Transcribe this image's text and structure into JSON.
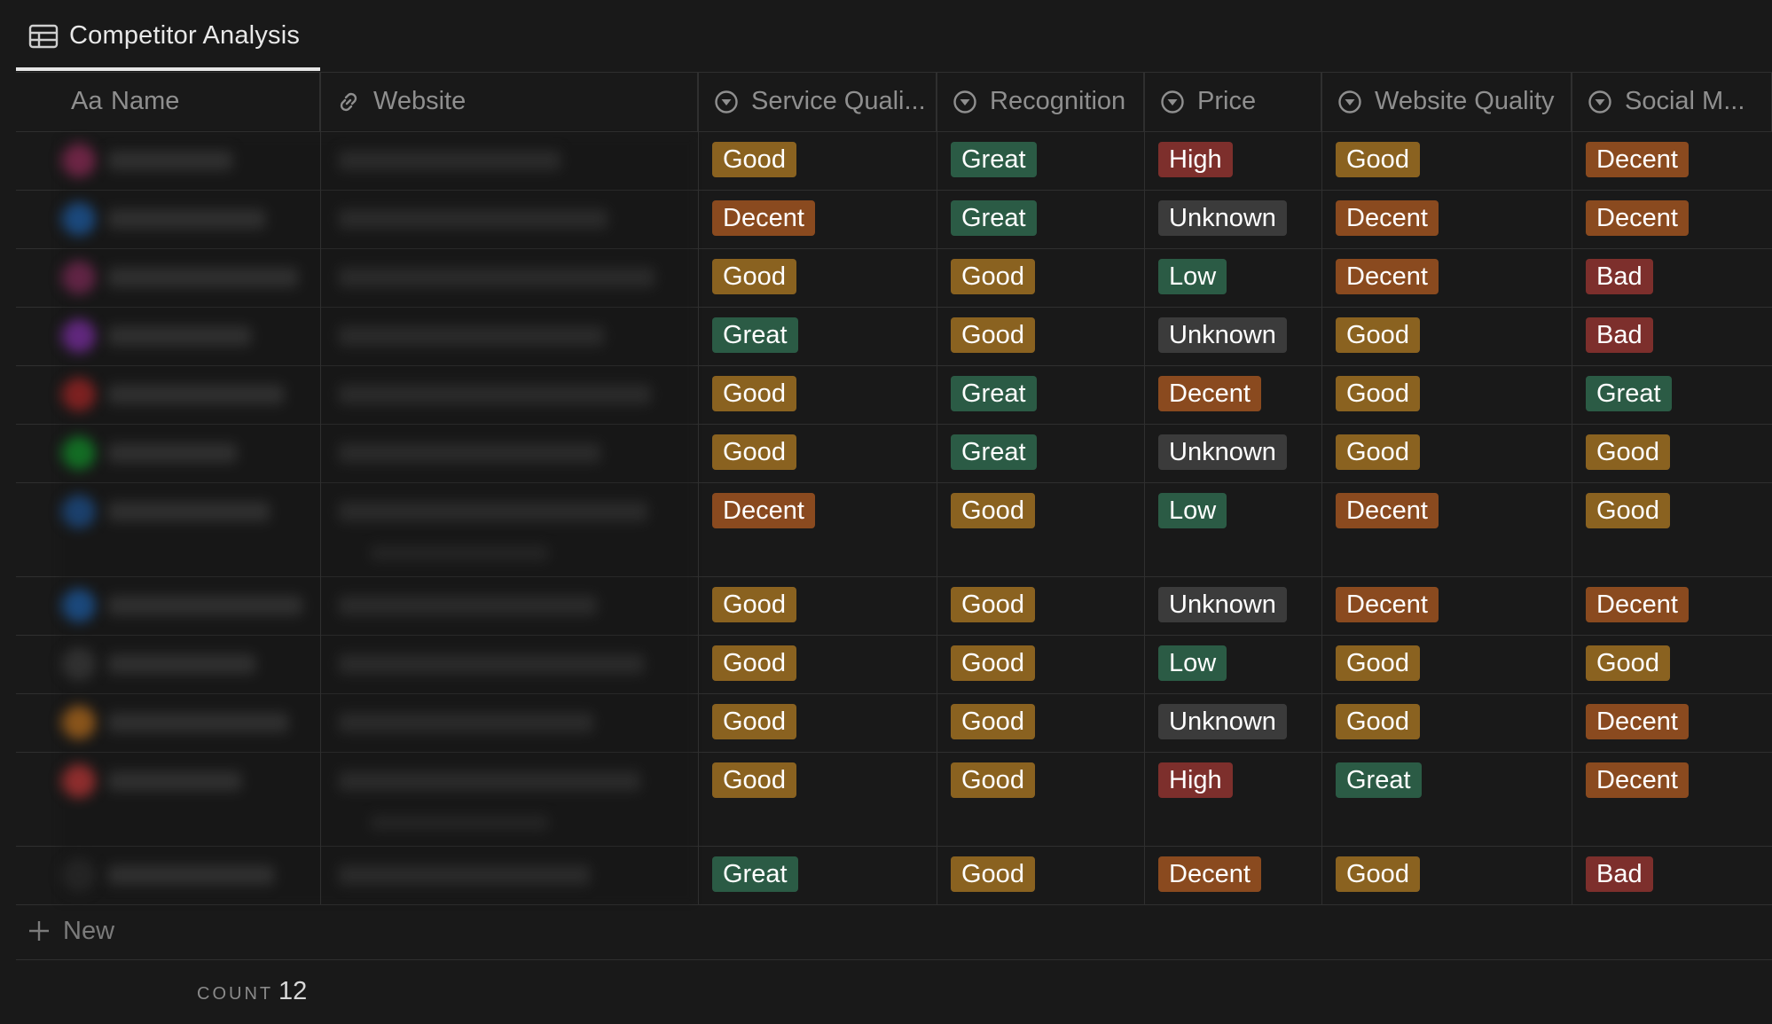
{
  "view_tab": {
    "label": "Competitor Analysis",
    "icon": "table-icon"
  },
  "columns": [
    {
      "key": "name",
      "label": "Name",
      "prefix": "Aa",
      "icon": "title-aa-icon"
    },
    {
      "key": "website",
      "label": "Website",
      "icon": "link-icon"
    },
    {
      "key": "service",
      "label": "Service Quali...",
      "icon": "select-icon"
    },
    {
      "key": "recognition",
      "label": "Recognition",
      "icon": "select-icon"
    },
    {
      "key": "price",
      "label": "Price",
      "icon": "select-icon"
    },
    {
      "key": "webquality",
      "label": "Website Quality",
      "icon": "select-icon"
    },
    {
      "key": "social",
      "label": "Social M...",
      "icon": "select-icon"
    }
  ],
  "tag_colors": {
    "Good": "#8a6220",
    "Great": "#2b5b45",
    "Decent": "#8a4a1f",
    "High": "#7d2f2c",
    "Low": "#2b5b45",
    "Unknown": "#3b3b3b",
    "Bad": "#7d2f2c"
  },
  "rows": [
    {
      "service": "Good",
      "recognition": "Great",
      "price": "High",
      "webquality": "Good",
      "social": "Decent",
      "avatar": "#8a2b55"
    },
    {
      "service": "Decent",
      "recognition": "Great",
      "price": "Unknown",
      "webquality": "Decent",
      "social": "Decent",
      "avatar": "#1e5a9e"
    },
    {
      "service": "Good",
      "recognition": "Good",
      "price": "Low",
      "webquality": "Decent",
      "social": "Bad",
      "avatar": "#7a2a55"
    },
    {
      "service": "Great",
      "recognition": "Good",
      "price": "Unknown",
      "webquality": "Good",
      "social": "Bad",
      "avatar": "#7a2ea0"
    },
    {
      "service": "Good",
      "recognition": "Great",
      "price": "Decent",
      "webquality": "Good",
      "social": "Great",
      "avatar": "#a02626"
    },
    {
      "service": "Good",
      "recognition": "Great",
      "price": "Unknown",
      "webquality": "Good",
      "social": "Good",
      "avatar": "#138a2a"
    },
    {
      "service": "Decent",
      "recognition": "Good",
      "price": "Low",
      "webquality": "Decent",
      "social": "Good",
      "avatar": "#1e4f8a"
    },
    {
      "service": "Good",
      "recognition": "Good",
      "price": "Unknown",
      "webquality": "Decent",
      "social": "Decent",
      "avatar": "#1e5a9e"
    },
    {
      "service": "Good",
      "recognition": "Good",
      "price": "Low",
      "webquality": "Good",
      "social": "Good",
      "avatar": "#3a3a3a"
    },
    {
      "service": "Good",
      "recognition": "Good",
      "price": "Unknown",
      "webquality": "Good",
      "social": "Decent",
      "avatar": "#b06a1e"
    },
    {
      "service": "Good",
      "recognition": "Good",
      "price": "High",
      "webquality": "Great",
      "social": "Decent",
      "avatar": "#b63636"
    },
    {
      "service": "Great",
      "recognition": "Good",
      "price": "Decent",
      "webquality": "Good",
      "social": "Bad",
      "avatar": "#2a2a2a"
    }
  ],
  "footer": {
    "new_label": "New",
    "count_label": "COUNT",
    "count_value": "12"
  }
}
